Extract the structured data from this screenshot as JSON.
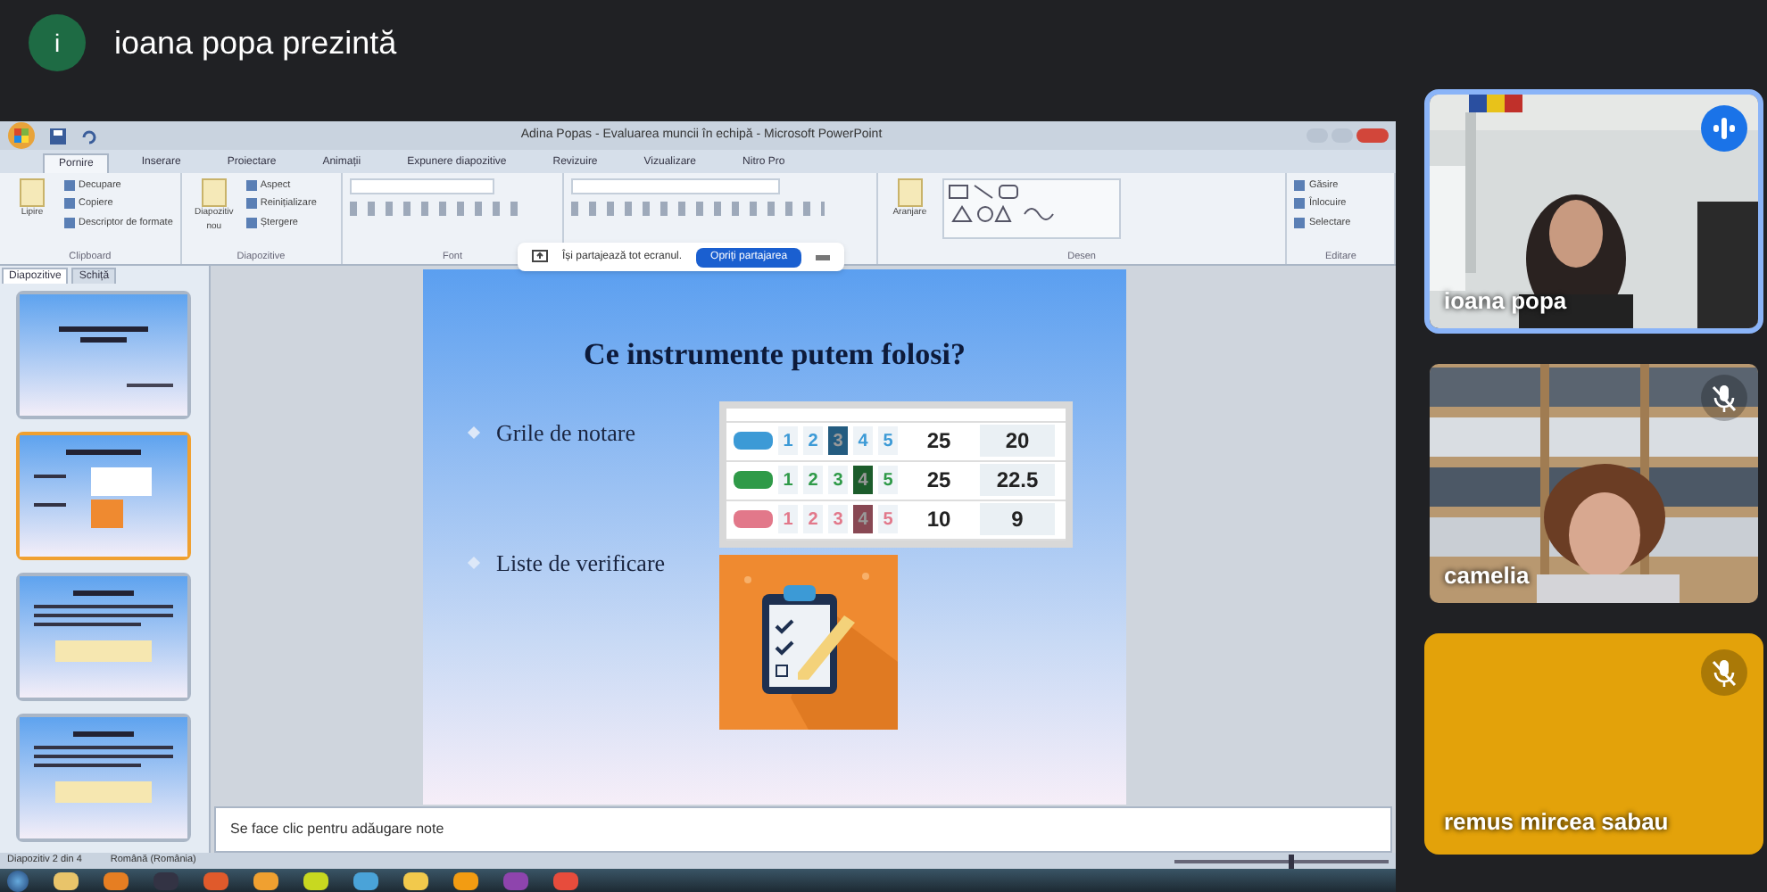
{
  "meet": {
    "presenter_initial": "i",
    "presenting_label": "ioana popa prezintă"
  },
  "powerpoint": {
    "title": "Adina Popas - Evaluarea muncii în echipă - Microsoft PowerPoint",
    "ribbon_tabs": [
      {
        "label": "Pornire",
        "selected": true
      },
      {
        "label": "Inserare",
        "selected": false
      },
      {
        "label": "Proiectare",
        "selected": false
      },
      {
        "label": "Animații",
        "selected": false
      },
      {
        "label": "Expunere diapozitive",
        "selected": false
      },
      {
        "label": "Revizuire",
        "selected": false
      },
      {
        "label": "Vizualizare",
        "selected": false
      },
      {
        "label": "Nitro Pro",
        "selected": false
      }
    ],
    "ribbon_groups": [
      {
        "kind": "clipboard",
        "label": "Clipboard",
        "big": "Lipire",
        "items": [
          "Decupare",
          "Copiere",
          "Descriptor de formate"
        ]
      },
      {
        "kind": "slides",
        "label": "Diapozitive",
        "big": "Diapozitiv nou",
        "items": [
          "Aspect",
          "Reinițializare",
          "Ștergere"
        ]
      },
      {
        "kind": "font",
        "label": "Font"
      },
      {
        "kind": "paragraph"
      },
      {
        "kind": "drawing",
        "label": "Desen",
        "big": "Aranjare"
      },
      {
        "kind": "editing",
        "label": "Editare",
        "items": [
          "Găsire",
          "Înlocuire",
          "Selectare"
        ]
      }
    ],
    "share_bar": {
      "message": "Își partajează tot ecranul.",
      "stop_button": "Opriți partajarea"
    },
    "pane_tabs": [
      {
        "label": "Diapozitive",
        "selected": true
      },
      {
        "label": "Schiță",
        "selected": false
      }
    ],
    "slides": [
      {
        "kind": "title",
        "selected": false
      },
      {
        "kind": "tools",
        "selected": true
      },
      {
        "kind": "text",
        "selected": false
      },
      {
        "kind": "text",
        "selected": false
      }
    ],
    "slide": {
      "title": "Ce instrumente putem folosi?",
      "bullets": [
        "Grile de notare",
        "Liste de verificare"
      ],
      "rubric": [
        {
          "color": "#3c9ad6",
          "cells": [
            {
              "text": "1",
              "selected": false
            },
            {
              "text": "2",
              "selected": false
            },
            {
              "text": "3",
              "selected": true
            },
            {
              "text": "4",
              "selected": false
            },
            {
              "text": "5",
              "selected": false
            }
          ],
          "max": "25",
          "score": "20"
        },
        {
          "color": "#2f9a48",
          "cells": [
            {
              "text": "1",
              "selected": false
            },
            {
              "text": "2",
              "selected": false
            },
            {
              "text": "3",
              "selected": false
            },
            {
              "text": "4",
              "selected": true
            },
            {
              "text": "5",
              "selected": false
            }
          ],
          "max": "25",
          "score": "22.5"
        },
        {
          "color": "#e2788a",
          "cells": [
            {
              "text": "1",
              "selected": false
            },
            {
              "text": "2",
              "selected": false
            },
            {
              "text": "3",
              "selected": false
            },
            {
              "text": "4",
              "selected": true
            },
            {
              "text": "5",
              "selected": false
            }
          ],
          "max": "10",
          "score": "9"
        }
      ]
    },
    "notes_placeholder": "Se face clic pentru adăugare note",
    "status": [
      "Diapozitiv 2 din 4",
      "Română (România)"
    ],
    "zoom_slider": {
      "level": 0.55
    }
  },
  "participants": [
    {
      "name": "ioana popa",
      "kind": "video",
      "speaking": true,
      "muted": false
    },
    {
      "name": "camelia",
      "kind": "video",
      "speaking": false,
      "muted": true
    },
    {
      "name": "remus mircea sabau",
      "kind": "color",
      "color": "#e3a20a",
      "speaking": false,
      "muted": true
    }
  ]
}
